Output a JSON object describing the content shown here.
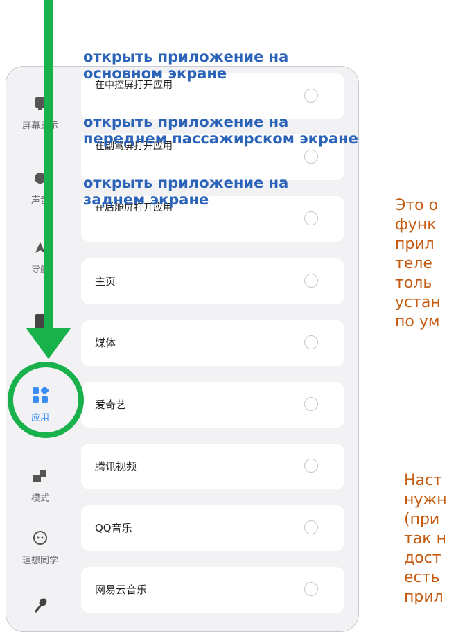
{
  "sidebar": {
    "items": [
      {
        "label": "屏幕显示",
        "icon": "screen-icon"
      },
      {
        "label": "声音",
        "icon": "sound-icon"
      },
      {
        "label": "导航",
        "icon": "navigation-icon"
      },
      {
        "label": "",
        "icon": "vehicle-icon"
      },
      {
        "label": "应用",
        "icon": "apps-icon",
        "active": true
      },
      {
        "label": "模式",
        "icon": "mode-icon"
      },
      {
        "label": "理想同学",
        "icon": "assistant-icon"
      },
      {
        "label": "",
        "icon": "microphone-icon"
      }
    ]
  },
  "options": [
    {
      "label": "在中控屏打开应用"
    },
    {
      "label": "在副驾屏打开应用"
    },
    {
      "label": "在后舱屏打开应用"
    }
  ],
  "apps": [
    {
      "label": "主页"
    },
    {
      "label": "媒体"
    },
    {
      "label": "爱奇艺"
    },
    {
      "label": "腾讯视频"
    },
    {
      "label": "QQ音乐"
    },
    {
      "label": "网易云音乐"
    }
  ],
  "annotations": {
    "a1": "открыть приложение на основном экране",
    "a1_l1": "открыть приложение на",
    "a1_l2": "основном экране",
    "a2_l1": "открыть приложение на",
    "a2_l2": "переднем пассажирском экране",
    "a3_l1": "открыть приложение на",
    "a3_l2": "заднем экране"
  },
  "note": {
    "lines1": [
      "Это о",
      "функ",
      "прил",
      "теле",
      "толь",
      "устан",
      "по ум"
    ],
    "lines2": [
      "Наст",
      "нужн",
      "(при",
      "так н",
      "дост",
      "есть",
      "прил"
    ]
  },
  "colors": {
    "accent": "#3a8df5",
    "arrow": "#19b14c",
    "annotation": "#2a63b8",
    "note": "#c55a11"
  }
}
